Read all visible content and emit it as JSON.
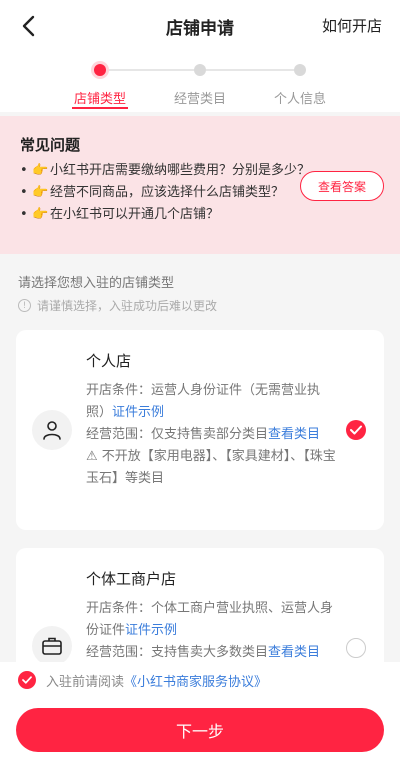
{
  "header": {
    "title": "店铺申请",
    "help_label": "如何开店"
  },
  "steps": [
    {
      "label": "店铺类型",
      "active": true
    },
    {
      "label": "经营类目",
      "active": false
    },
    {
      "label": "个人信息",
      "active": false
    }
  ],
  "faq": {
    "title": "常见问题",
    "bullet": "•",
    "hand": "👉",
    "items": [
      "小红书开店需要缴纳哪些费用？分别是多少？",
      "经营不同商品，应该选择什么店铺类型？",
      "在小红书可以开通几个店铺？"
    ],
    "button_label": "查看答案"
  },
  "prompt": "请选择您想入驻的店铺类型",
  "warning": "请谨慎选择，入驻成功后难以更改",
  "cards": [
    {
      "name": "个人店",
      "condition_prefix": "开店条件：运营人身份证件（无需营业执照）",
      "condition_link": "证件示例",
      "scope_prefix": "经营范围：仅支持售卖部分类目",
      "scope_link": "查看类目",
      "restriction": "不开放【家用电器】、【家具建材】、【珠宝玉石】等类目",
      "selected": true
    },
    {
      "name": "个体工商户店",
      "condition_prefix": "开店条件：个体工商户营业执照、运营人身份证件",
      "condition_link": "证件示例",
      "scope_prefix": "经营范围：支持售卖大多数类目",
      "scope_link": "查看类目",
      "selected": false
    }
  ],
  "agreement": {
    "prefix": "入驻前请阅读",
    "link": "《小红书商家服务协议》"
  },
  "next_label": "下一步",
  "colors": {
    "accent": "#ff2442",
    "link": "#3b7ddb",
    "faq_bg": "#fbe3e6"
  }
}
